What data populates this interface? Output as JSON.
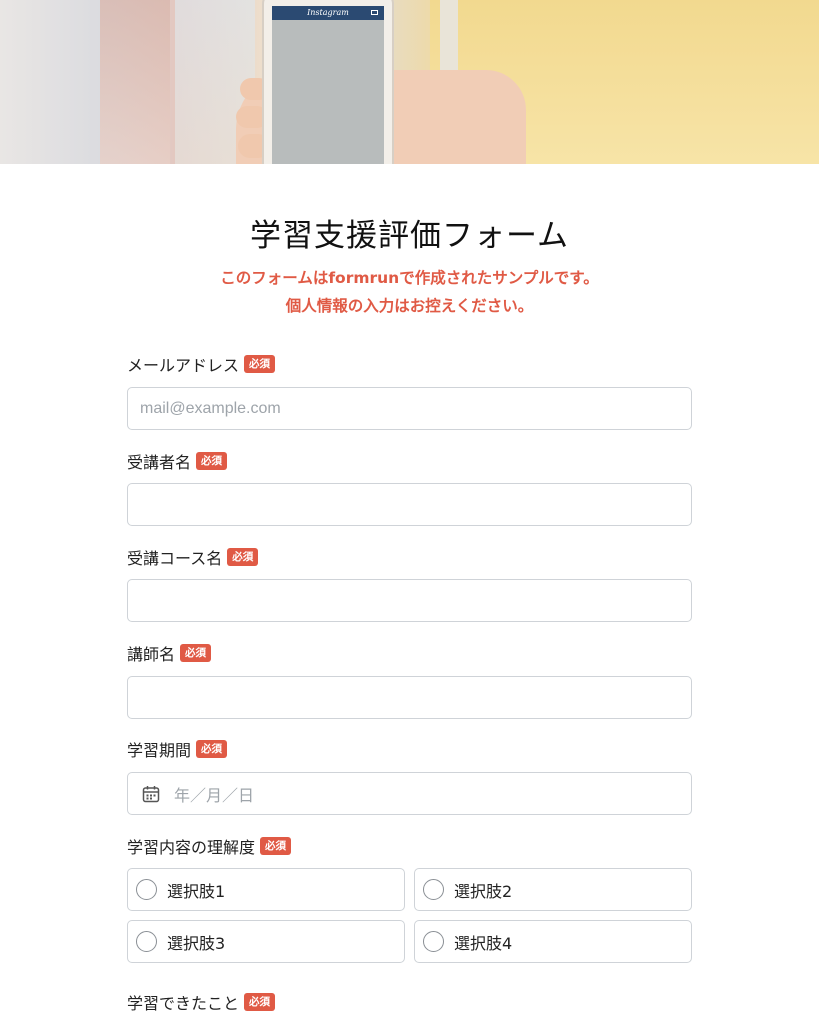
{
  "hero": {
    "phone_app_label": "Instagram"
  },
  "form": {
    "title": "学習支援評価フォーム",
    "notice_line1": "このフォームはformrunで作成されたサンプルです。",
    "notice_line2": "個人情報の入力はお控えください。",
    "required_badge": "必須",
    "fields": {
      "email": {
        "label": "メールアドレス",
        "placeholder": "mail@example.com",
        "value": ""
      },
      "student_name": {
        "label": "受講者名",
        "value": ""
      },
      "course_name": {
        "label": "受講コース名",
        "value": ""
      },
      "instructor_name": {
        "label": "講師名",
        "value": ""
      },
      "study_period": {
        "label": "学習期間",
        "placeholder": "年／月／日",
        "icon": "calendar-icon"
      },
      "understanding": {
        "label": "学習内容の理解度",
        "options": [
          "選択肢1",
          "選択肢2",
          "選択肢3",
          "選択肢4"
        ]
      },
      "achievements": {
        "label": "学習できたこと"
      }
    }
  },
  "colors": {
    "accent": "#e05a45",
    "border": "#cfd3d8",
    "placeholder": "#9ea4aa"
  }
}
